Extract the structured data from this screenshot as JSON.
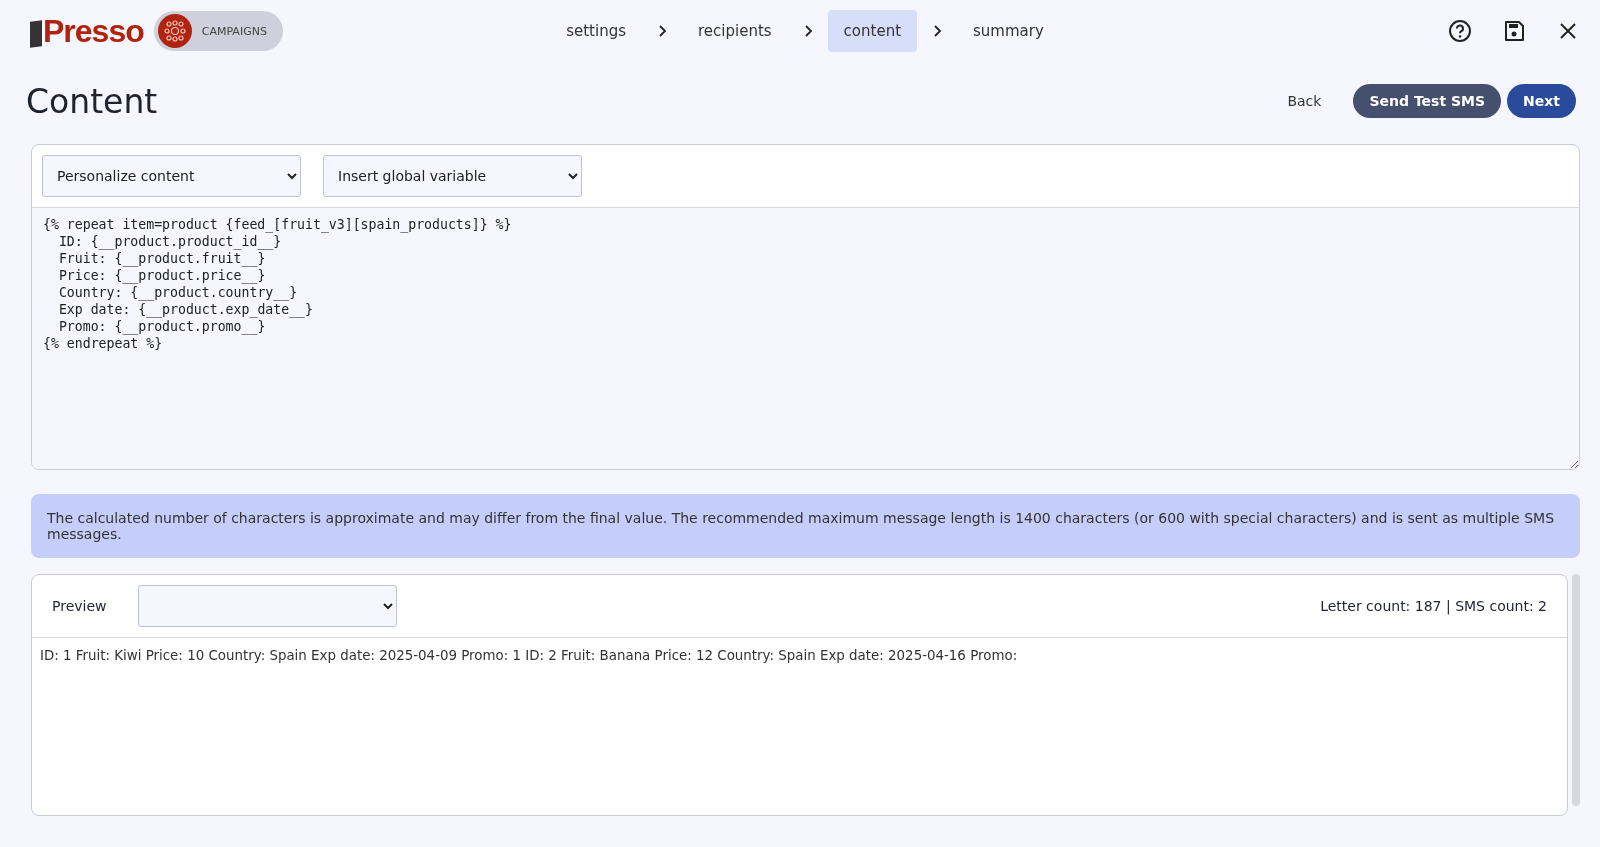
{
  "header": {
    "logo": "Presso",
    "module": "CAMPAIGNS"
  },
  "steps": [
    {
      "label": "settings",
      "selected": false
    },
    {
      "label": "recipients",
      "selected": false
    },
    {
      "label": "content",
      "selected": true
    },
    {
      "label": "summary",
      "selected": false
    }
  ],
  "page_title": "Content",
  "actions": {
    "back": "Back",
    "test": "Send Test SMS",
    "next": "Next"
  },
  "editor": {
    "personalize_select": "Personalize content",
    "global_select": "Insert global variable",
    "code": "{% repeat item=product {feed_[fruit_v3][spain_products]} %}\n  ID: {__product.product_id__}\n  Fruit: {__product.fruit__}\n  Price: {__product.price__}\n  Country: {__product.country__}\n  Exp date: {__product.exp_date__}\n  Promo: {__product.promo__}\n{% endrepeat %}"
  },
  "info": "The calculated number of characters is approximate and may differ from the final value. The recommended maximum message length is 1400 characters (or 600 with special characters) and is sent as multiple SMS messages.",
  "preview": {
    "label": "Preview",
    "counts": "Letter count: 187 | SMS count: 2",
    "text": "ID: 1 Fruit: Kiwi Price: 10 Country: Spain Exp date: 2025-04-09 Promo: 1 ID: 2 Fruit: Banana Price: 12 Country: Spain Exp date: 2025-04-16 Promo:"
  }
}
